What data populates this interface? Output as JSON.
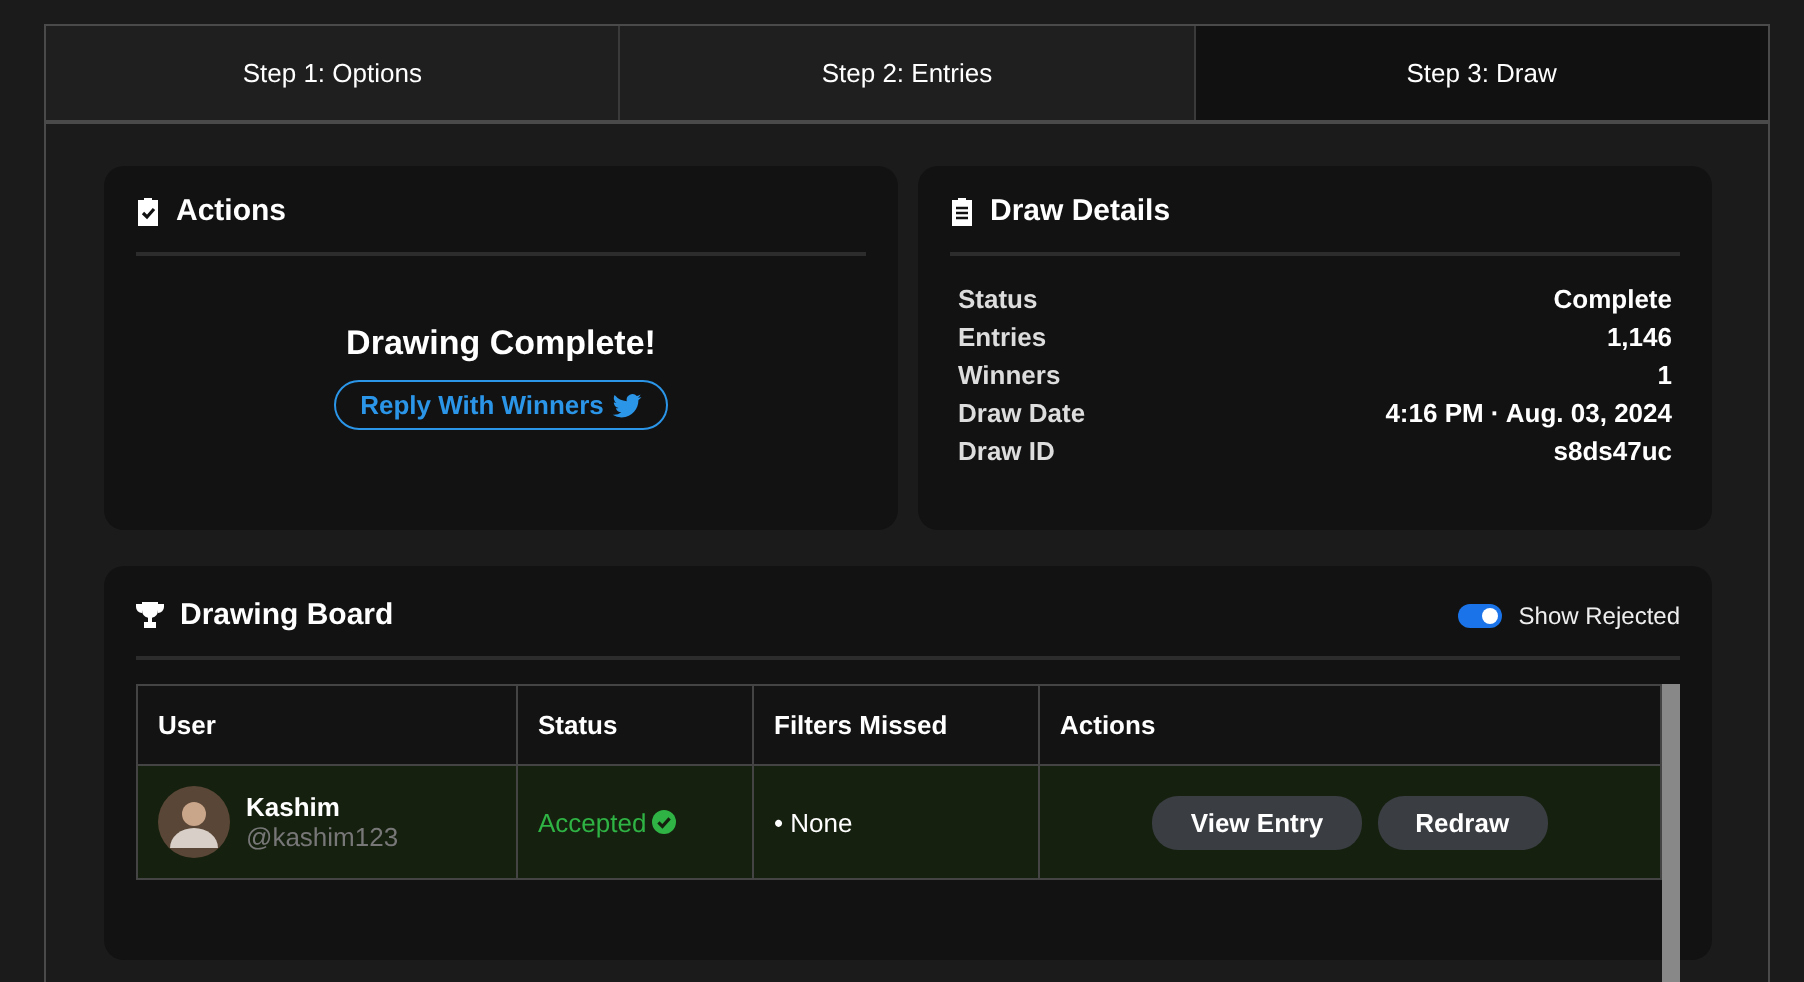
{
  "tabs": [
    {
      "label": "Step 1: Options",
      "selected": false
    },
    {
      "label": "Step 2: Entries",
      "selected": false
    },
    {
      "label": "Step 3: Draw",
      "selected": true
    }
  ],
  "actions": {
    "title": "Actions",
    "message": "Drawing Complete!",
    "button": "Reply With Winners"
  },
  "draw_details": {
    "title": "Draw Details",
    "rows": [
      {
        "label": "Status",
        "value": "Complete"
      },
      {
        "label": "Entries",
        "value": "1,146"
      },
      {
        "label": "Winners",
        "value": "1"
      },
      {
        "label": "Draw Date",
        "value": "4:16 PM · Aug. 03, 2024"
      },
      {
        "label": "Draw ID",
        "value": "s8ds47uc"
      }
    ]
  },
  "drawing_board": {
    "title": "Drawing Board",
    "show_rejected": {
      "label": "Show Rejected",
      "on": true
    },
    "table": {
      "columns": [
        "User",
        "Status",
        "Filters Missed",
        "Actions"
      ],
      "rows": [
        {
          "name": "Kashim",
          "handle": "@kashim123",
          "status": "Accepted",
          "accepted": true,
          "filters_missed": "• None",
          "buttons": [
            "View Entry",
            "Redraw"
          ]
        }
      ]
    }
  }
}
